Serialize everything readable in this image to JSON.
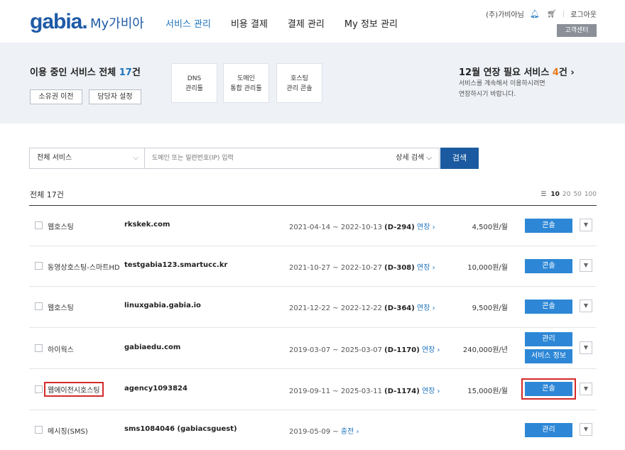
{
  "header": {
    "logo": "gabia.",
    "logo_sub": "My가비아",
    "nav": [
      "서비스 관리",
      "비용 결제",
      "결제 관리",
      "My 정보 관리"
    ],
    "user": "(주)가비아님",
    "logout": "로그아웃",
    "cs_button": "고객센터"
  },
  "summary": {
    "title_prefix": "이용 중인 서비스 전체 ",
    "count": "17",
    "title_suffix": "건",
    "transfer_button": "소유권 이전",
    "manager_button": "담당자 설정",
    "quick_links": [
      {
        "line1": "DNS",
        "line2": "관리툴"
      },
      {
        "line1": "도메인",
        "line2": "통합 관리툴"
      },
      {
        "line1": "호스팅",
        "line2": "관리 콘솔"
      }
    ],
    "renew_prefix": "12월 연장 필요 서비스 ",
    "renew_count": "4",
    "renew_suffix": "건 ›",
    "renew_desc_1": "서비스를 계속해서 이용하시려면",
    "renew_desc_2": "연장하시기 바랍니다."
  },
  "search": {
    "select_value": "전체 서비스",
    "placeholder": "도메인 또는 일련번호(IP) 입력",
    "advanced": "상세 검색",
    "button": "검색"
  },
  "list": {
    "total_label": "전체 17건",
    "page_sizes": [
      "10",
      "20",
      "50",
      "100"
    ],
    "rows": [
      {
        "service": "웹호스팅",
        "domain": "rkskek.com",
        "period": "2021-04-14 ~ 2022-10-13",
        "dday": "(D-294)",
        "action_link": "연장 ›",
        "price": "4,500원/월",
        "buttons": [
          "콘솔"
        ]
      },
      {
        "service": "동영상호스팅-스마트HD",
        "domain": "testgabia123.smartucc.kr",
        "period": "2021-10-27 ~ 2022-10-27",
        "dday": "(D-308)",
        "action_link": "연장 ›",
        "price": "10,000원/월",
        "buttons": [
          "콘솔"
        ]
      },
      {
        "service": "웹호스팅",
        "domain": "linuxgabia.gabia.io",
        "period": "2021-12-22 ~ 2022-12-22",
        "dday": "(D-364)",
        "action_link": "연장 ›",
        "price": "9,500원/월",
        "buttons": [
          "콘솔"
        ]
      },
      {
        "service": "하이웍스",
        "domain": "gabiaedu.com",
        "period": "2019-03-07 ~ 2025-03-07",
        "dday": "(D-1170)",
        "action_link": "연장 ›",
        "price": "240,000원/년",
        "buttons": [
          "관리",
          "서비스 정보"
        ]
      },
      {
        "service": "웹에이전시호스팅",
        "domain": "agency1093824",
        "period": "2019-09-11 ~ 2025-03-11",
        "dday": "(D-1174)",
        "action_link": "연장 ›",
        "price": "15,000원/월",
        "buttons": [
          "콘솔"
        ]
      },
      {
        "service": "메시징(SMS)",
        "domain": "sms1084046 (gabiacsguest)",
        "period": "2019-05-09 ~",
        "dday": "",
        "action_link": "충전 ›",
        "price": "",
        "buttons": [
          "관리"
        ]
      }
    ]
  }
}
